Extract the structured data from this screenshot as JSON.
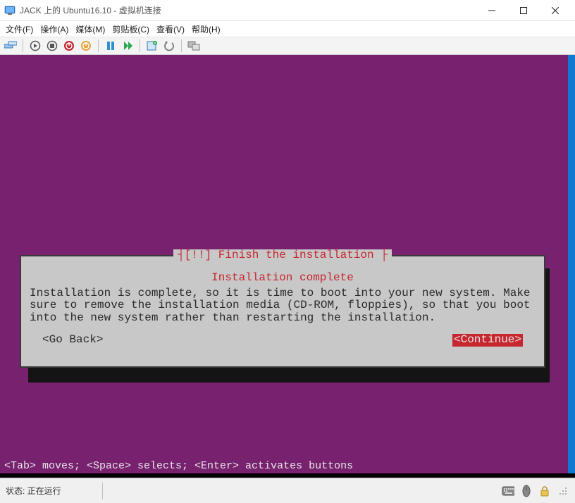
{
  "window": {
    "title": "JACK 上的 Ubuntu16.10 - 虚拟机连接"
  },
  "menu": {
    "file": "文件(F)",
    "action": "操作(A)",
    "media": "媒体(M)",
    "clipboard": "剪贴板(C)",
    "view": "查看(V)",
    "help": "帮助(H)"
  },
  "dialog": {
    "title_brackets_prefix": "[!!] ",
    "title": "Finish the installation",
    "subtitle": "Installation complete",
    "body": "Installation is complete, so it is time to boot into your new system. Make sure to remove the installation media (CD-ROM, floppies), so that you boot into the new system rather than restarting the installation.",
    "go_back": "<Go Back>",
    "continue": "<Continue>"
  },
  "help_line": "<Tab> moves; <Space> selects; <Enter> activates buttons",
  "status": {
    "label": "状态: 正在运行"
  }
}
